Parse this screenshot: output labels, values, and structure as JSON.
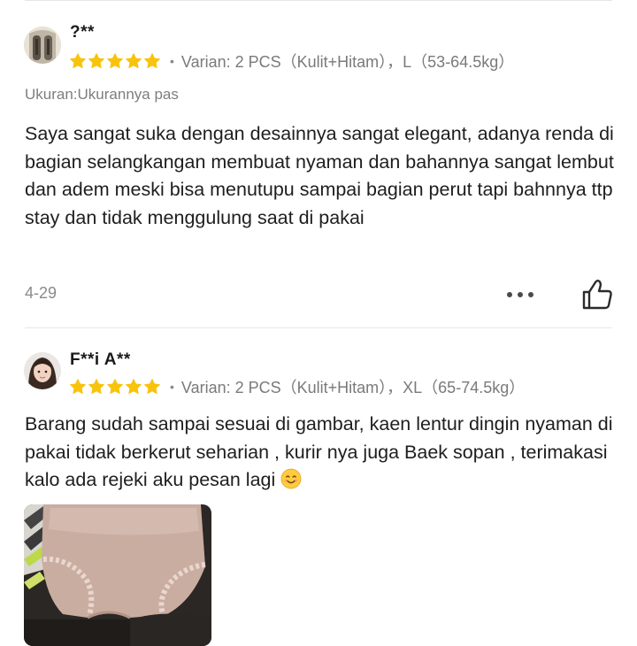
{
  "reviews": [
    {
      "username": "?**",
      "variant": "Varian: 2 PCS（Kulit+Hitam），L（53-64.5kg）",
      "size_note": "Ukuran:Ukurannya pas",
      "text": "Saya sangat suka dengan desainnya  sangat elegant, adanya renda di bagian selangkangan membuat nyaman dan bahannya sangat lembut dan adem  meski  bisa menutupu sampai bagian perut tapi  bahnnya ttp stay dan tidak menggulung  saat di pakai",
      "date": "4-29",
      "rating": 5
    },
    {
      "username": "F**i A**",
      "variant": "Varian: 2 PCS（Kulit+Hitam），XL（65-74.5kg）",
      "text": "Barang sudah sampai sesuai di gambar, kaen lentur dingin nyaman di pakai tidak berkerut seharian , kurir nya juga Baek sopan , terimakasi  kalo ada rejeki aku pesan lagi",
      "rating": 5
    }
  ],
  "icons": {
    "star": "star-icon",
    "more": "more-icon",
    "like": "thumbs-up-icon",
    "emoji": "smiling-face-emoji"
  },
  "colors": {
    "star": "#F8C30C",
    "text": "#1E1E1E",
    "muted": "#7A7A7A",
    "divider": "#E6E6E6"
  }
}
